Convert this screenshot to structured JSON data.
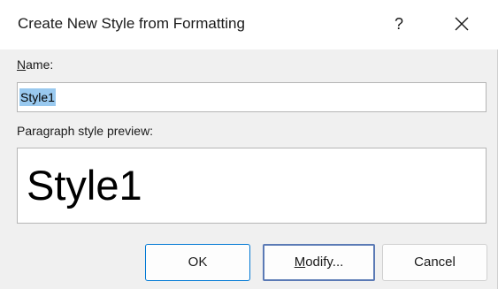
{
  "dialog": {
    "title": "Create New Style from Formatting",
    "help_label": "?",
    "name_label_key": "N",
    "name_label_rest": "ame:",
    "name_value": "Style1",
    "preview_label": "Paragraph style preview:",
    "preview_text": "Style1",
    "buttons": {
      "ok": "OK",
      "modify_key": "M",
      "modify_rest": "odify...",
      "cancel": "Cancel"
    }
  },
  "icons": {
    "help": "help-icon",
    "close": "close-icon"
  },
  "colors": {
    "dialog_bg": "#f0f0f0",
    "titlebar_bg": "#ffffff",
    "selection": "#99c9ef",
    "default_button_border": "#0078d4",
    "highlight_border": "#5b7ab5"
  }
}
